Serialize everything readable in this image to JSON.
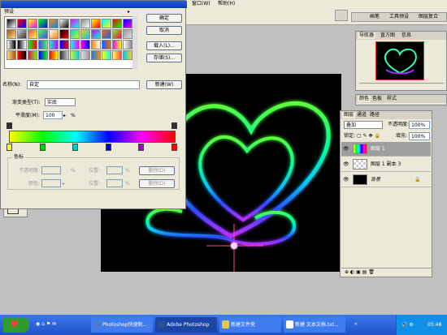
{
  "menubar": {
    "items": [
      "窗口(W)",
      "帮助(H)"
    ]
  },
  "palette_tabs": [
    "画笔",
    "工具预设",
    "图层复合"
  ],
  "dialog": {
    "presets_label": "预设",
    "ok_label": "确定",
    "cancel_label": "取消",
    "load_label": "载入(L)...",
    "save_label": "存储(S)...",
    "name_label": "名称(N):",
    "name_value": "自定",
    "new_label": "新建(W)",
    "gradient_type_label": "渐变类型(T):",
    "gradient_type_value": "实底",
    "smoothness_label": "平滑度(M):",
    "smoothness_value": "100",
    "smoothness_unit": "%",
    "stops_label": "色标",
    "opacity_label": "不透明度:",
    "opacity_unit": "%",
    "location_label": "位置:",
    "location_unit": "%",
    "delete_label": "删除(D)",
    "color_label": "颜色:",
    "location2_label": "位置:",
    "location2_unit": "%",
    "delete2_label": "删除(D)",
    "gradient_colors": [
      "#ffff00",
      "#00ff00",
      "#00ffff",
      "#0000ff",
      "#ff00ff",
      "#ff0000"
    ],
    "stop_colors": [
      "#ffff00",
      "#00cc00",
      "#00cccc",
      "#0000dd",
      "#aa00cc",
      "#ff0000"
    ]
  },
  "navigator": {
    "tabs": [
      "导航器",
      "直方图",
      "信息"
    ]
  },
  "color_tabs": [
    "颜色",
    "色板",
    "样式"
  ],
  "layers": {
    "tabs": [
      "图层",
      "通道",
      "路径"
    ],
    "blend_mode": "叠加",
    "opacity_label": "不透明度:",
    "opacity_value": "100%",
    "lock_label": "锁定:",
    "fill_label": "填充:",
    "fill_value": "100%",
    "items": [
      {
        "name": "图层 1"
      },
      {
        "name": "图层 1 副本 3"
      },
      {
        "name": "背景"
      }
    ]
  },
  "taskbar": {
    "tasks": [
      "Photoshop快速制...",
      "Adobe Photoshop",
      "新建文件夹",
      "新建 文本文档.txt..."
    ],
    "clock": "05:48"
  },
  "colors": {
    "taskbar": "#2457d4",
    "dialog_title": "#0a3cb8",
    "selection": "#9e9e9e"
  }
}
